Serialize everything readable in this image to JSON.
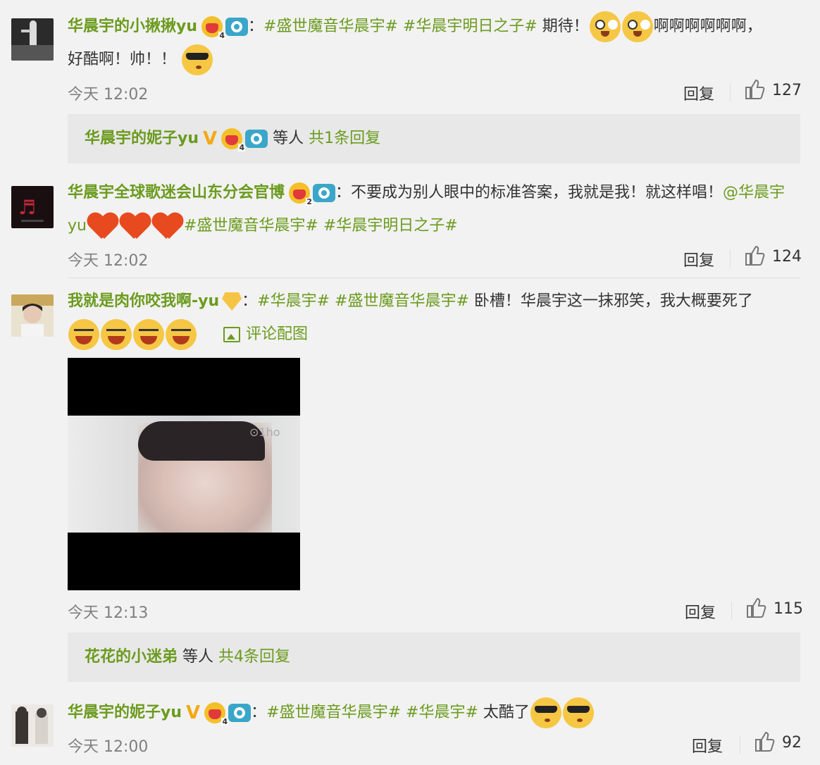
{
  "comments": [
    {
      "username": "华晨宇的小揪揪yu",
      "level": "4",
      "content_parts": [
        {
          "kind": "colon",
          "text": "："
        },
        {
          "kind": "tag",
          "text": "#盛世魔音华晨宇#"
        },
        {
          "kind": "tag",
          "text": "#华晨宇明日之子#"
        },
        {
          "kind": "text",
          "text": "期待！"
        },
        {
          "kind": "emoji",
          "text": "eyes"
        },
        {
          "kind": "emoji",
          "text": "eyes"
        },
        {
          "kind": "text",
          "text": "啊啊啊啊啊啊，"
        },
        {
          "kind": "text",
          "text": "好酷啊！帅！！"
        },
        {
          "kind": "emoji",
          "text": "cool"
        }
      ],
      "time": "今天 12:02",
      "reply_label": "回复",
      "likes": "127",
      "reply_summary": {
        "user": "华晨宇的妮子yu",
        "level": "4",
        "mid": "等人",
        "count_text": "共1条回复"
      }
    },
    {
      "username": "华晨宇全球歌迷会山东分会官博",
      "level": "2",
      "time": "今天 12:02",
      "reply_label": "回复",
      "likes": "124",
      "text": "不要成为别人眼中的标准答案，我就是我！就这样唱！",
      "mention": "@华晨宇yu",
      "tags": [
        "#盛世魔音华晨宇#",
        "#华晨宇明日之子#"
      ]
    },
    {
      "username": "我就是肉你咬我啊-yu",
      "time": "今天 12:13",
      "reply_label": "回复",
      "likes": "115",
      "tags": [
        "#华晨宇#",
        "#盛世魔音华晨宇#"
      ],
      "text": "卧槽！华晨宇这一抹邪笑，我大概要死了",
      "photo_link": "评论配图",
      "watermark": "⊙1ho",
      "reply_summary": {
        "user": "花花的小迷弟",
        "mid": "等人",
        "count_text": "共4条回复"
      }
    },
    {
      "username": "华晨宇的妮子yu",
      "level": "4",
      "time": "今天 12:00",
      "reply_label": "回复",
      "likes": "92",
      "tags": [
        "#盛世魔音华晨宇#",
        "#华晨宇#"
      ],
      "text": "太酷了"
    }
  ],
  "colon": "："
}
